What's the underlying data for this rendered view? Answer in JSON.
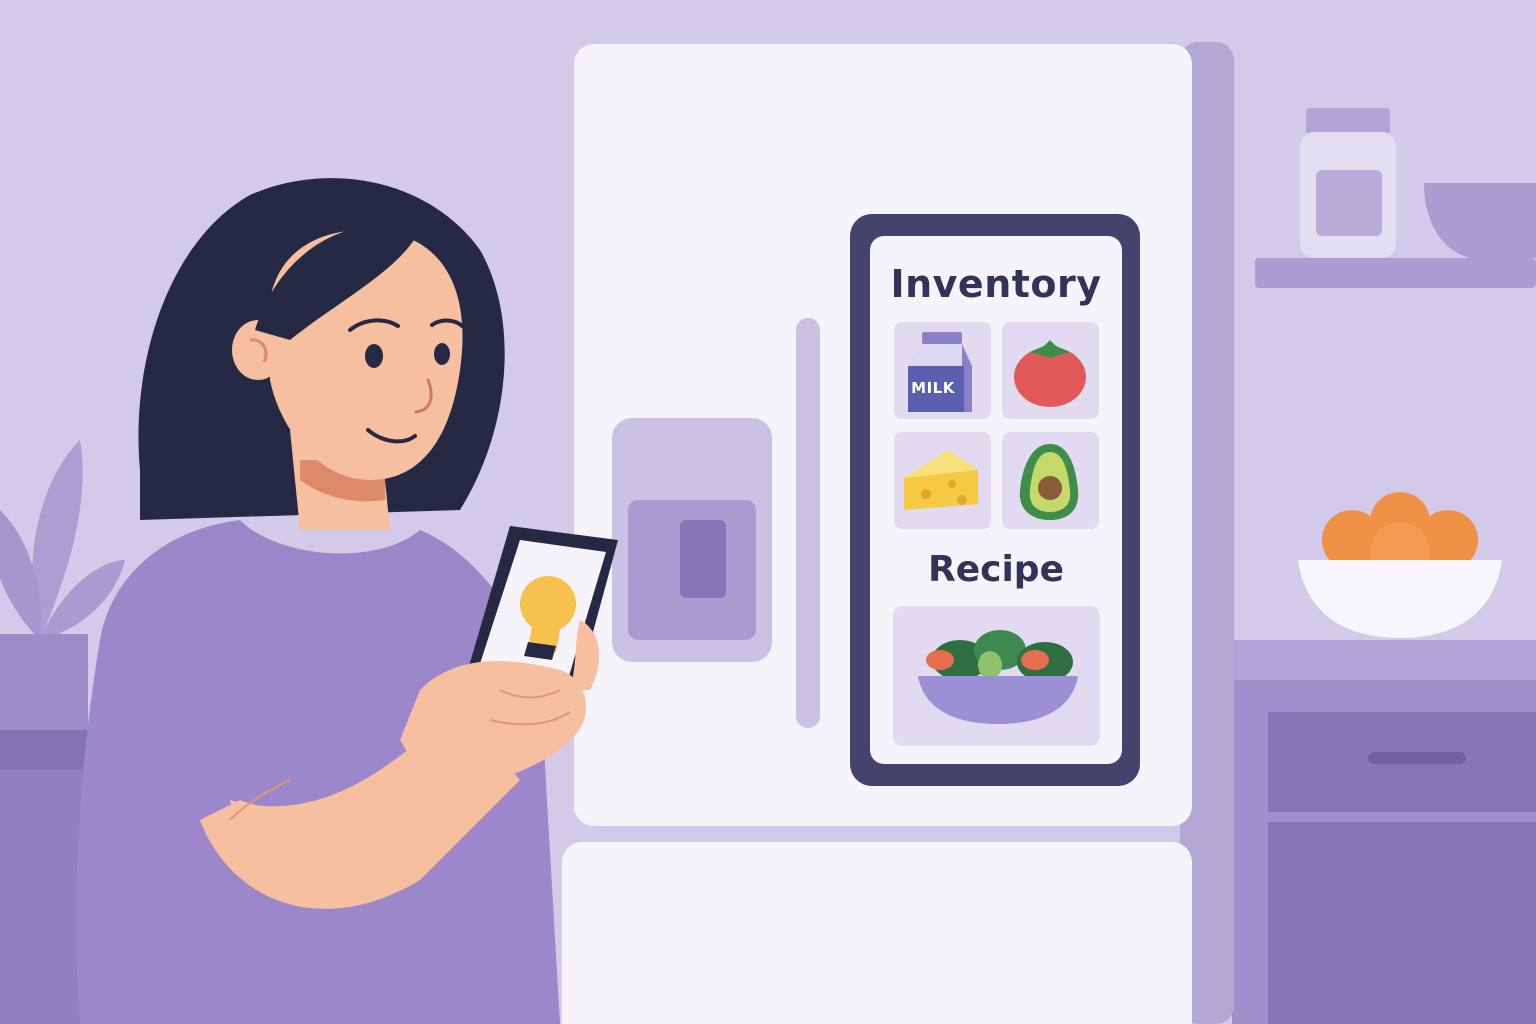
{
  "fridge_screen": {
    "inventory_title": "Inventory",
    "inventory_items": [
      {
        "name": "milk-carton-icon",
        "label": "MILK"
      },
      {
        "name": "tomato-icon"
      },
      {
        "name": "cheese-icon"
      },
      {
        "name": "avocado-icon"
      }
    ],
    "recipe_title": "Recipe",
    "recipe_item": {
      "name": "salad-bowl-icon"
    }
  },
  "phone": {
    "screen_icon": "lightbulb-icon"
  },
  "colors": {
    "background": "#d3c9e8",
    "fridge": "#f7f3fb",
    "screen_frame": "#44436e",
    "shirt": "#9b87c9",
    "skin": "#f5bfa0",
    "hair": "#252943",
    "accent_orange": "#ef9145"
  }
}
